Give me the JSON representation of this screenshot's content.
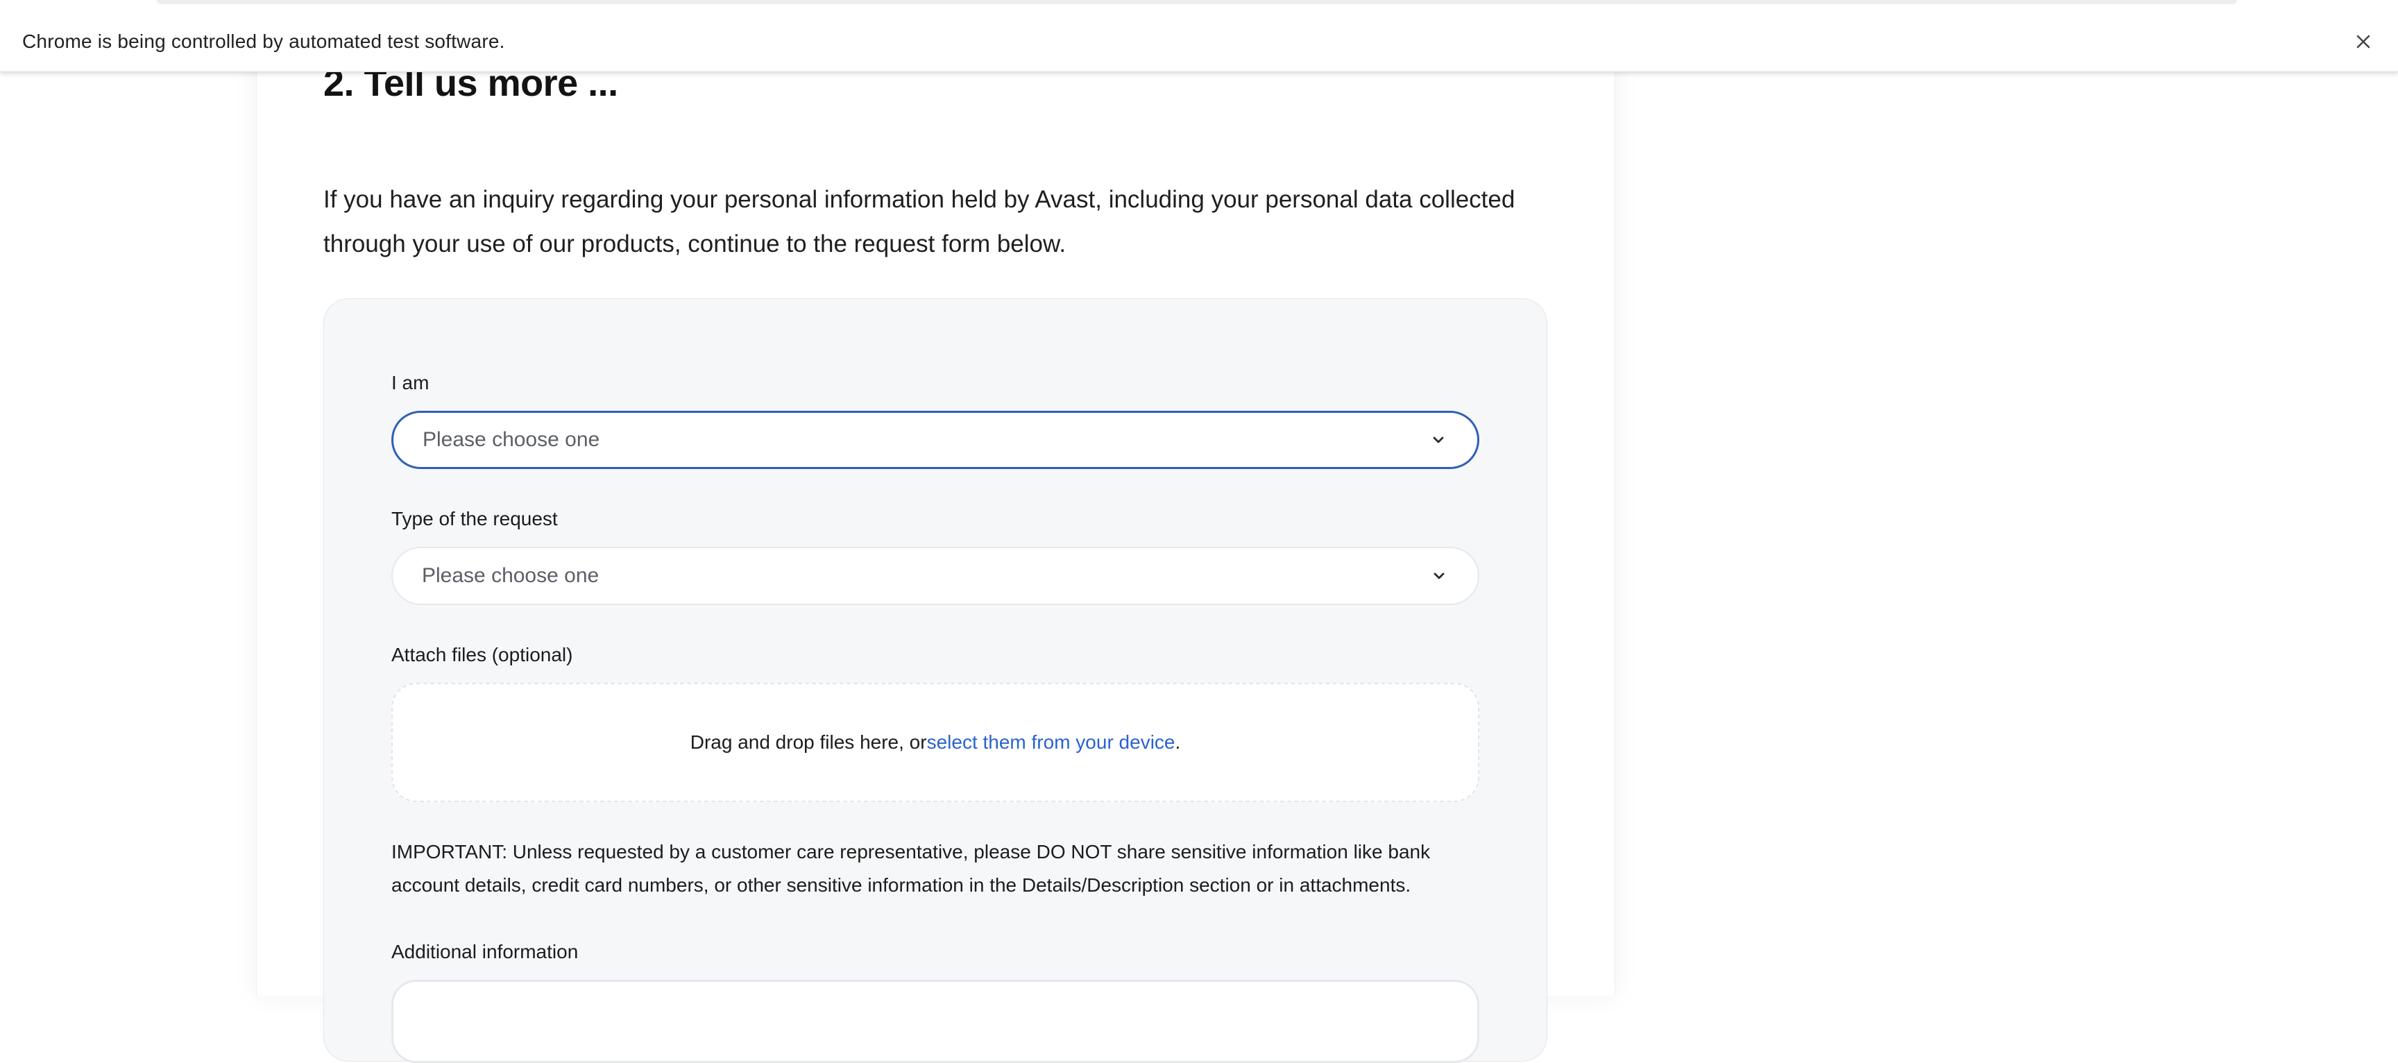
{
  "browser": {
    "infobar_text": "Chrome is being controlled by automated test software.",
    "close_icon": "close-icon"
  },
  "section": {
    "title": "2. Tell us more ...",
    "intro": "If you have an inquiry regarding your personal information held by Avast, including your personal data collected through your use of our products, continue to the request form below."
  },
  "form": {
    "i_am": {
      "label": "I am",
      "placeholder": "Please choose one",
      "icon": "chevron-down-icon"
    },
    "request_type": {
      "label": "Type of the request",
      "placeholder": "Please choose one",
      "icon": "chevron-down-icon"
    },
    "attachments": {
      "label": "Attach files (optional)",
      "text_before": "Drag and drop files here, or ",
      "link_text": "select them from your device",
      "text_after": "."
    },
    "important_notice": "IMPORTANT: Unless requested by a customer care representative, please DO NOT share sensitive information like bank account details, credit card numbers, or other sensitive information in the Details/Description section or in attachments.",
    "additional_info": {
      "label": "Additional information"
    }
  },
  "colors": {
    "accent": "#2f5fb8",
    "link": "#2a63cf",
    "panel_bg": "#f6f7f9"
  }
}
